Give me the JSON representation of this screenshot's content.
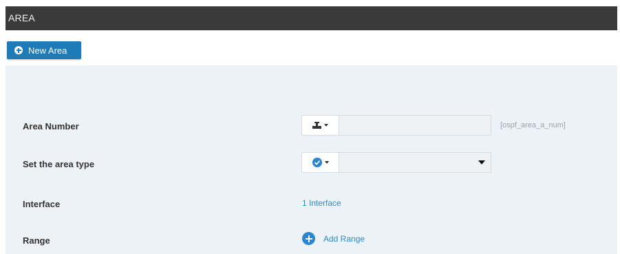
{
  "header": {
    "title": "AREA"
  },
  "toolbar": {
    "new_area_label": "New Area"
  },
  "form": {
    "area_number": {
      "label": "Area Number",
      "value": "",
      "hint": "[ospf_area_a_num]",
      "addon_icon": "pipeline-icon"
    },
    "area_type": {
      "label": "Set the area type",
      "selected": "",
      "addon_icon": "check-circle-icon"
    },
    "interface": {
      "label": "Interface",
      "link_text": "1 Interface"
    },
    "range": {
      "label": "Range",
      "link_text": "Add Range"
    }
  },
  "colors": {
    "header_bg": "#3a3a3a",
    "accent": "#1f7ab8",
    "link": "#2a8ad0",
    "panel_bg": "#edf2f7"
  }
}
